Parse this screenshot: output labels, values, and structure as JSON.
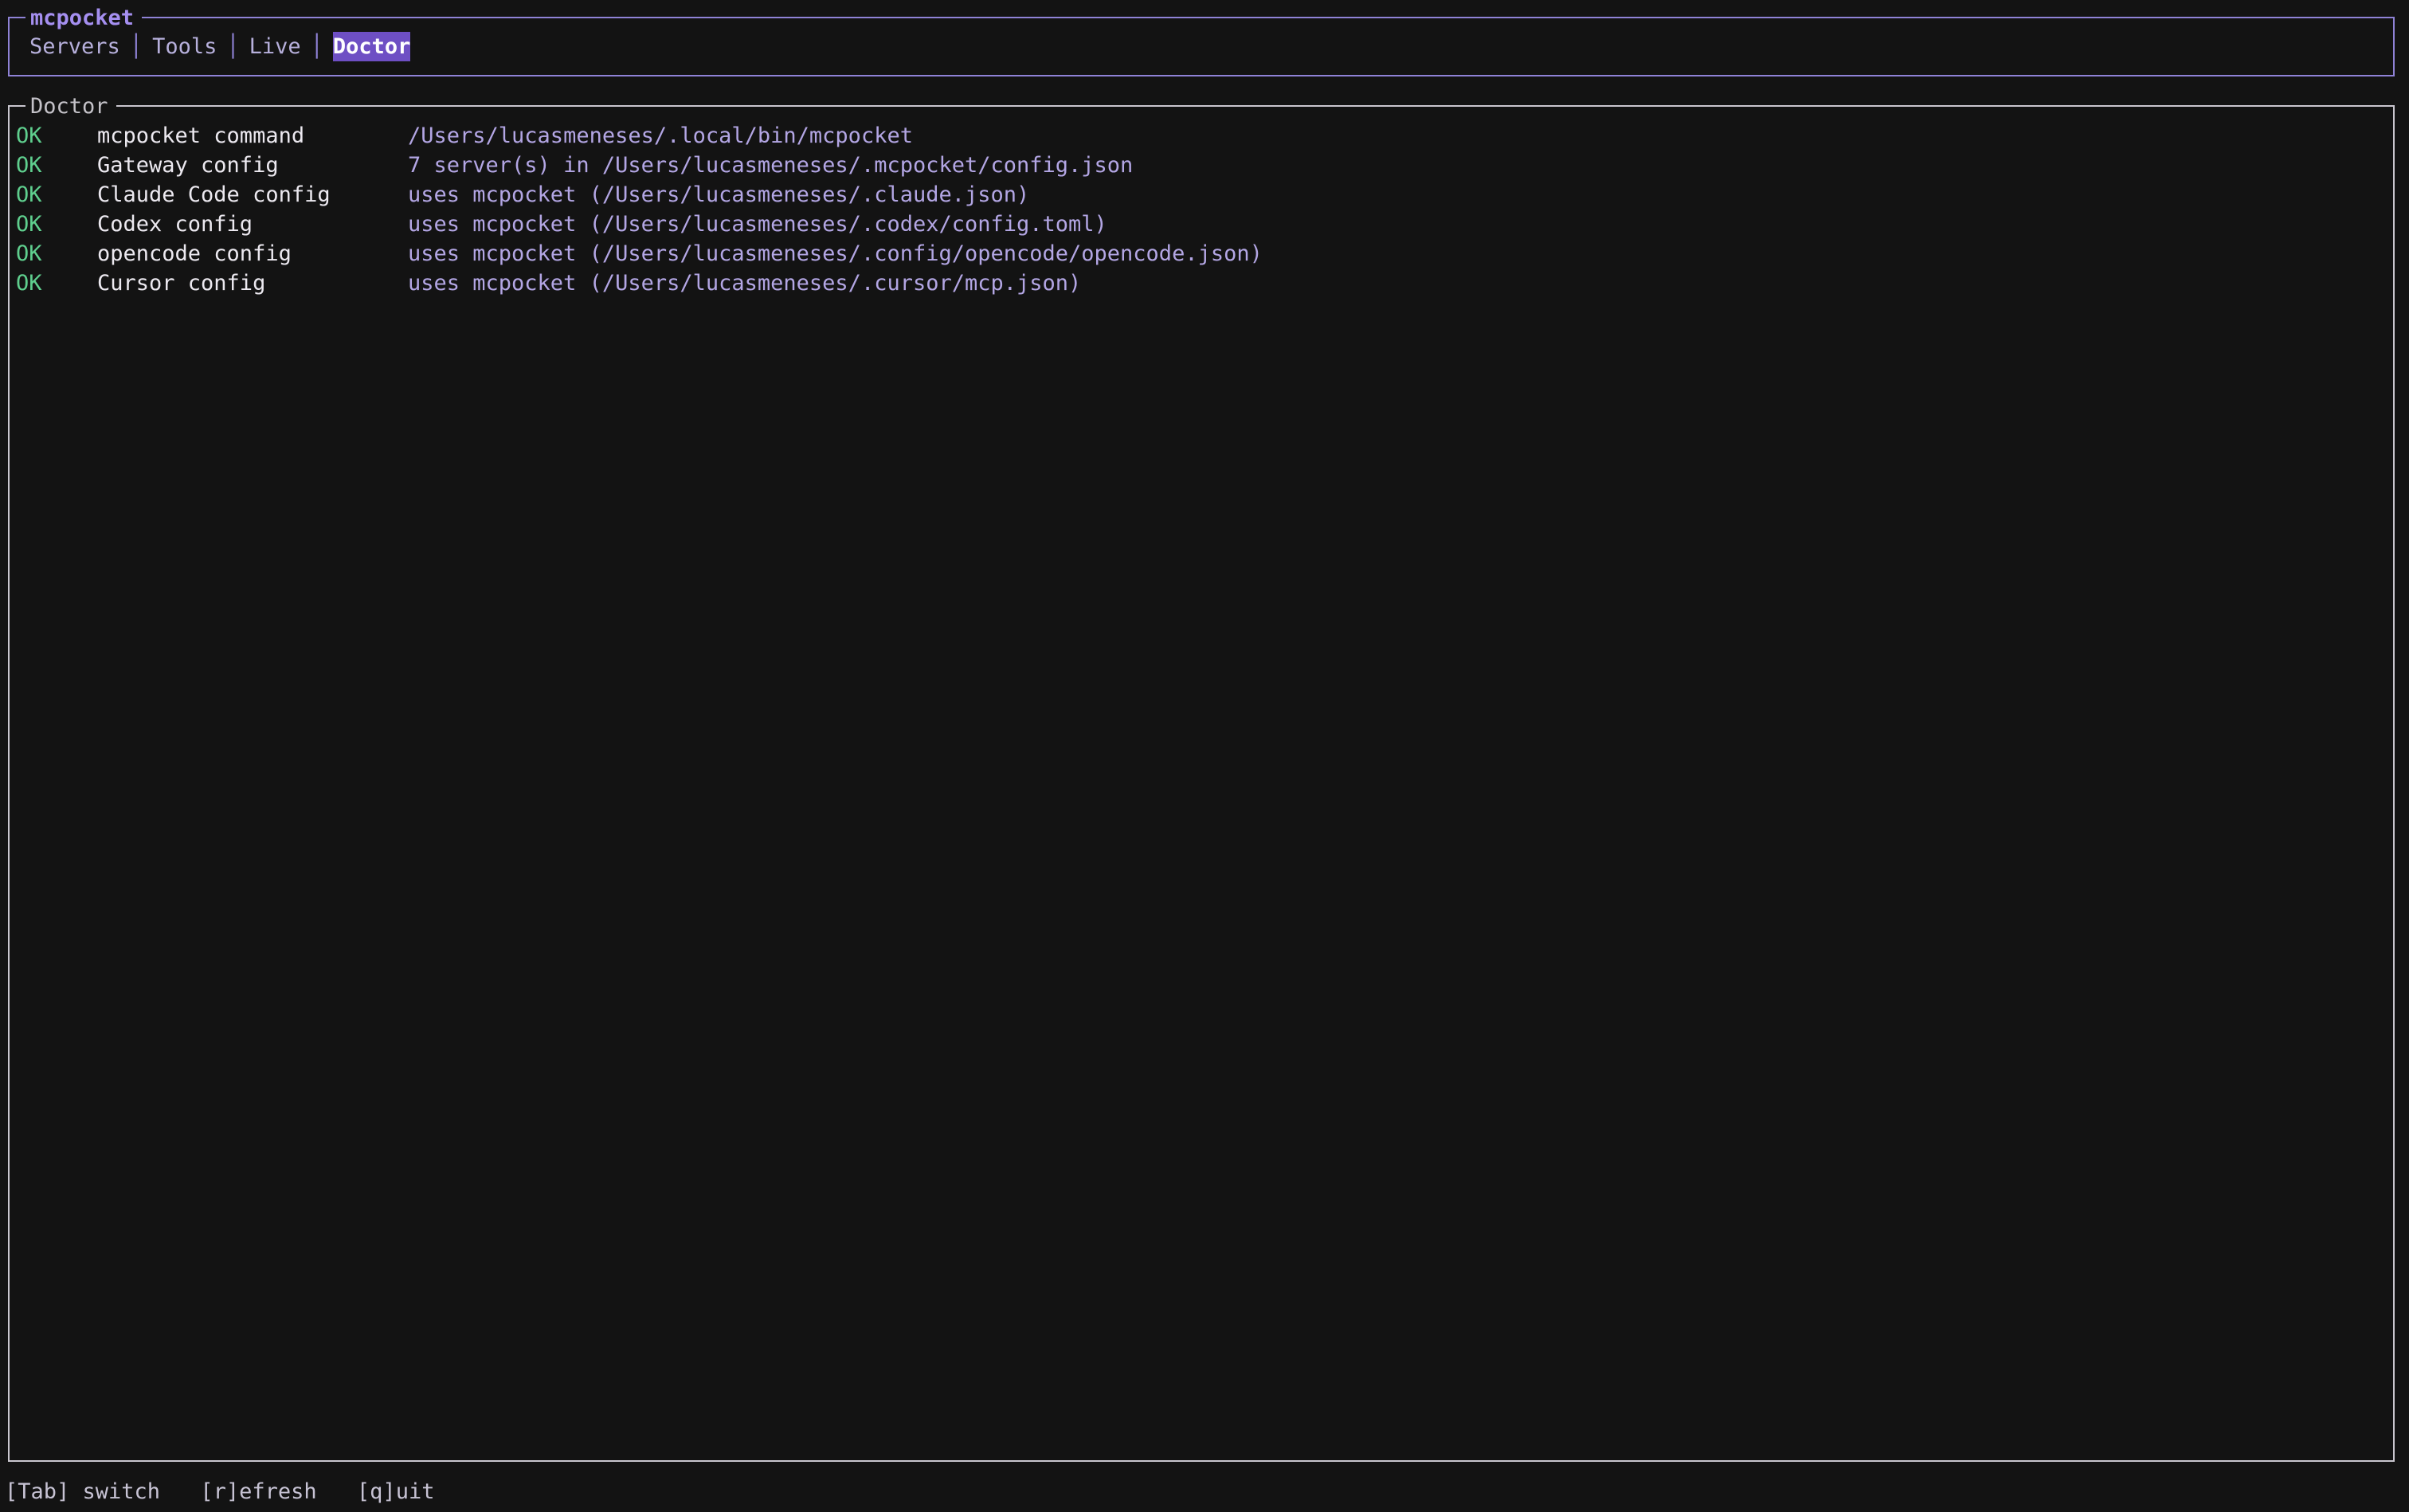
{
  "app": {
    "title": "mcpocket"
  },
  "tabs": [
    {
      "label": "Servers",
      "active": false
    },
    {
      "label": "Tools",
      "active": false
    },
    {
      "label": "Live",
      "active": false
    },
    {
      "label": "Doctor",
      "active": true
    }
  ],
  "panel": {
    "title": "Doctor"
  },
  "checks": [
    {
      "status": "OK",
      "name": "mcpocket command",
      "detail": "/Users/lucasmeneses/.local/bin/mcpocket"
    },
    {
      "status": "OK",
      "name": "Gateway config",
      "detail": "7 server(s) in /Users/lucasmeneses/.mcpocket/config.json"
    },
    {
      "status": "OK",
      "name": "Claude Code config",
      "detail": "uses mcpocket (/Users/lucasmeneses/.claude.json)"
    },
    {
      "status": "OK",
      "name": "Codex config",
      "detail": "uses mcpocket (/Users/lucasmeneses/.codex/config.toml)"
    },
    {
      "status": "OK",
      "name": "opencode config",
      "detail": "uses mcpocket (/Users/lucasmeneses/.config/opencode/opencode.json)"
    },
    {
      "status": "OK",
      "name": "Cursor config",
      "detail": "uses mcpocket (/Users/lucasmeneses/.cursor/mcp.json)"
    }
  ],
  "footer": {
    "switch": "[Tab] switch",
    "refresh": "[r]efresh",
    "quit": "[q]uit"
  },
  "colors": {
    "accent": "#6e4fc4",
    "ok": "#5fcf8e",
    "detail": "#b3a6e4",
    "background": "#131313"
  }
}
